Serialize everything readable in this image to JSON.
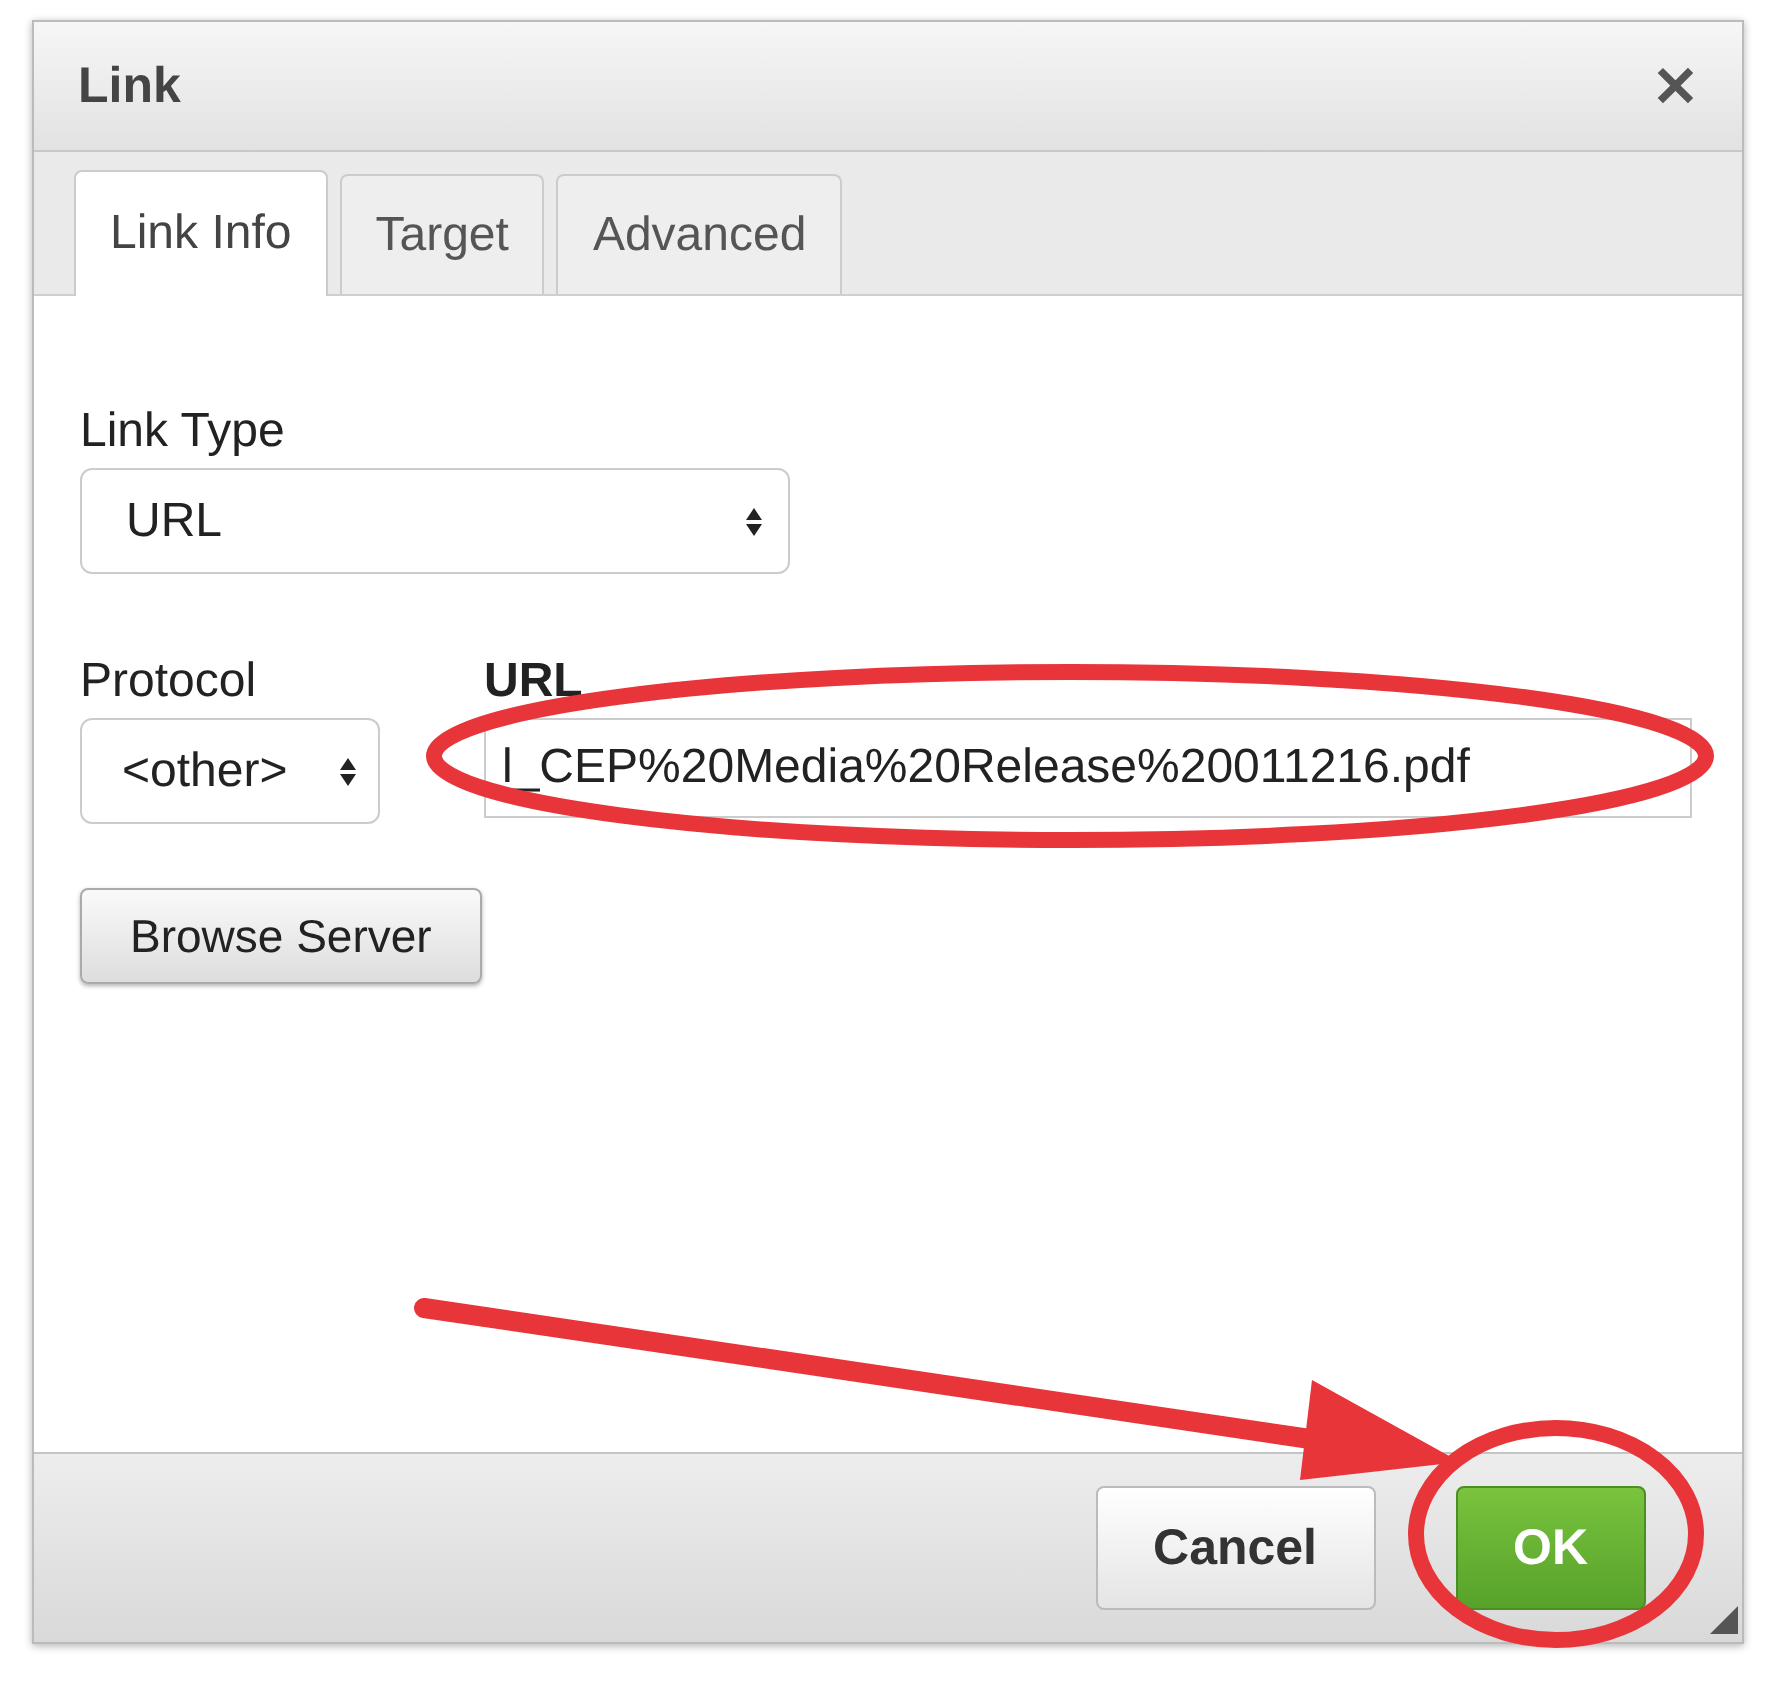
{
  "dialog": {
    "title": "Link",
    "close": "✕"
  },
  "tabs": [
    {
      "label": "Link Info",
      "selected": true
    },
    {
      "label": "Target",
      "selected": false
    },
    {
      "label": "Advanced",
      "selected": false
    }
  ],
  "link_type": {
    "label": "Link Type",
    "value": "URL"
  },
  "protocol": {
    "label": "Protocol",
    "value": "<other>"
  },
  "url": {
    "label": "URL",
    "value": "l_CEP%20Media%20Release%20011216.pdf"
  },
  "browse_button": "Browse Server",
  "buttons": [
    {
      "label": "Cancel",
      "kind": "secondary"
    },
    {
      "label": "OK",
      "kind": "primary"
    }
  ]
}
